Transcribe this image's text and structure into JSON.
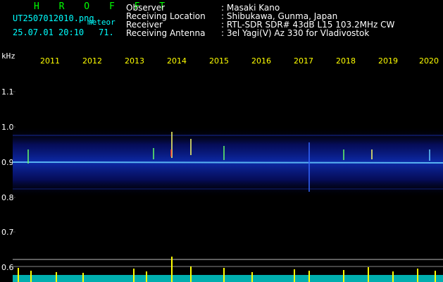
{
  "header": {
    "title": "H R O F F T",
    "filename": "UT2507012010.png",
    "tag": "meteor",
    "datetime": "25.07.01 20:10",
    "count": "71.",
    "fields": [
      {
        "label": "Observer",
        "value": ": Masaki Kano"
      },
      {
        "label": "Receiving Location",
        "value": ": Shibukawa, Gunma, Japan"
      },
      {
        "label": "Receiver",
        "value": ": RTL-SDR SDR# 43dB L15 103.2MHz CW"
      },
      {
        "label": "Receiving Antenna",
        "value": ": 3el Yagi(V) Az 330 for Vladivostok"
      }
    ]
  },
  "axis": {
    "unit": "kHz",
    "y_ticks": [
      "1.1",
      "1.0",
      "0.9",
      "0.8",
      "0.7",
      "0.6"
    ],
    "x_ticks": [
      "2011",
      "2012",
      "2013",
      "2014",
      "2015",
      "2016",
      "2017",
      "2018",
      "2019",
      "2020"
    ]
  },
  "colors": {
    "background": "#000000",
    "title": "#00ff00",
    "info": "#00ffff",
    "labels": "#ffffff",
    "time_ticks": "#ffff00",
    "noise_band": "#0a1a8c",
    "trace": "#66ccff",
    "echo_bars": "#ffff00",
    "level_base": "#00ffff"
  }
}
